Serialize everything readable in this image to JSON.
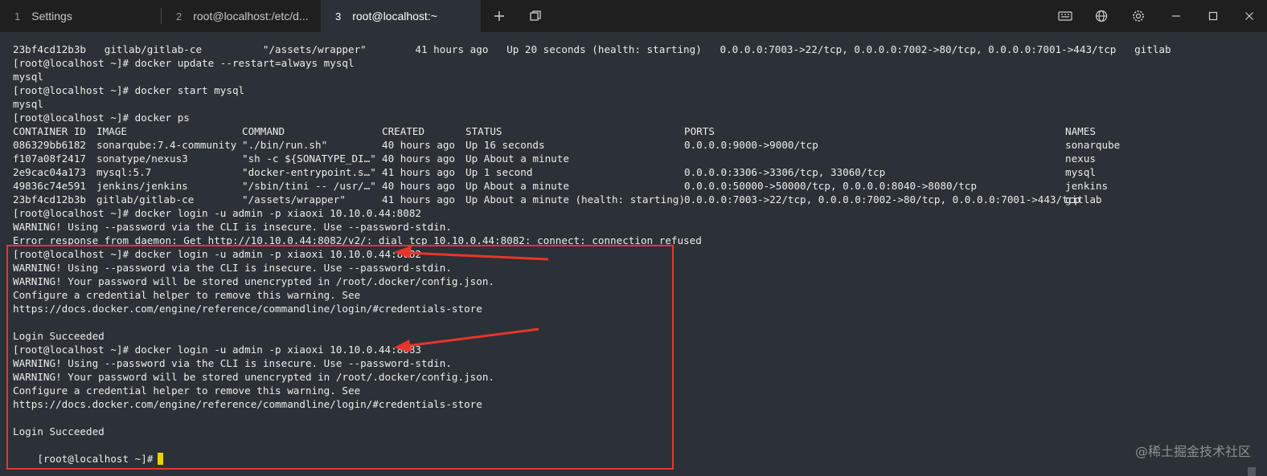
{
  "tabs": [
    {
      "number": "1",
      "title": "Settings"
    },
    {
      "number": "2",
      "title": "root@localhost:/etc/d..."
    },
    {
      "number": "3",
      "title": "root@localhost:~"
    }
  ],
  "window_controls": {
    "new_tab": "new-tab",
    "duplicate": "duplicate-tab",
    "keyboard": "keyboard-icon",
    "globe": "globe-icon",
    "settings": "gear-icon",
    "minimize": "minimize",
    "maximize": "maximize",
    "close": "close"
  },
  "terminal": {
    "lines": [
      "23bf4cd12b3b   gitlab/gitlab-ce          \"/assets/wrapper\"        41 hours ago   Up 20 seconds (health: starting)   0.0.0.0:7003->22/tcp, 0.0.0.0:7002->80/tcp, 0.0.0.0:7001->443/tcp   gitlab",
      "[root@localhost ~]# docker update --restart=always mysql",
      "mysql",
      "[root@localhost ~]# docker start mysql",
      "mysql",
      "[root@localhost ~]# docker ps"
    ],
    "ps_header": [
      "CONTAINER ID",
      "IMAGE",
      "COMMAND",
      "CREATED",
      "STATUS",
      "PORTS",
      "NAMES"
    ],
    "ps_rows": [
      [
        "086329bb6182",
        "sonarqube:7.4-community",
        "\"./bin/run.sh\"",
        "40 hours ago",
        "Up 16 seconds",
        "0.0.0.0:9000->9000/tcp",
        "sonarqube"
      ],
      [
        "f107a08f2417",
        "sonatype/nexus3",
        "\"sh -c ${SONATYPE_DI…\"",
        "40 hours ago",
        "Up About a minute",
        "",
        "nexus"
      ],
      [
        "2e9cac04a173",
        "mysql:5.7",
        "\"docker-entrypoint.s…\"",
        "41 hours ago",
        "Up 1 second",
        "0.0.0.0:3306->3306/tcp, 33060/tcp",
        "mysql"
      ],
      [
        "49836c74e591",
        "jenkins/jenkins",
        "\"/sbin/tini -- /usr/…\"",
        "40 hours ago",
        "Up About a minute",
        "0.0.0.0:50000->50000/tcp, 0.0.0.0:8040->8080/tcp",
        "jenkins"
      ],
      [
        "23bf4cd12b3b",
        "gitlab/gitlab-ce",
        "\"/assets/wrapper\"",
        "41 hours ago",
        "Up About a minute (health: starting)",
        "0.0.0.0:7003->22/tcp, 0.0.0.0:7002->80/tcp, 0.0.0.0:7001->443/tcp",
        "gitlab"
      ]
    ],
    "after_lines": [
      "[root@localhost ~]# docker login -u admin -p xiaoxi 10.10.0.44:8082",
      "WARNING! Using --password via the CLI is insecure. Use --password-stdin.",
      "Error response from daemon: Get http://10.10.0.44:8082/v2/: dial tcp 10.10.0.44:8082: connect: connection refused",
      "[root@localhost ~]# docker login -u admin -p xiaoxi 10.10.0.44:8082",
      "WARNING! Using --password via the CLI is insecure. Use --password-stdin.",
      "WARNING! Your password will be stored unencrypted in /root/.docker/config.json.",
      "Configure a credential helper to remove this warning. See",
      "https://docs.docker.com/engine/reference/commandline/login/#credentials-store",
      "",
      "Login Succeeded",
      "[root@localhost ~]# docker login -u admin -p xiaoxi 10.10.0.44:8083",
      "WARNING! Using --password via the CLI is insecure. Use --password-stdin.",
      "WARNING! Your password will be stored unencrypted in /root/.docker/config.json.",
      "Configure a credential helper to remove this warning. See",
      "https://docs.docker.com/engine/reference/commandline/login/#credentials-store",
      "",
      "Login Succeeded"
    ],
    "prompt": "[root@localhost ~]#"
  },
  "watermark": "@稀土掘金技术社区",
  "colors": {
    "background": "#2b3136",
    "tabbar": "#1f1f1f",
    "annotation": "#e8352c",
    "cursor": "#f0d000"
  }
}
